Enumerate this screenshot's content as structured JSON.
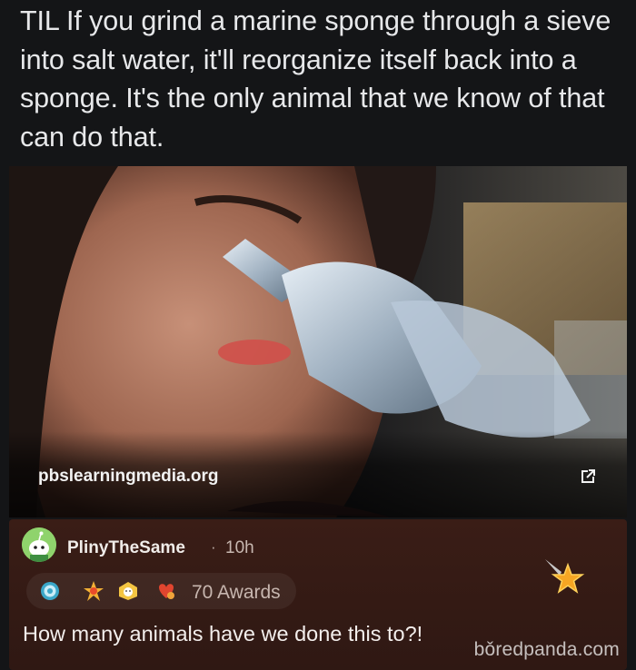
{
  "post": {
    "title": "TIL If you grind a marine sponge through a sieve into salt water, it'll reorganize itself back into a sponge. It's the only animal that we know of that can do that."
  },
  "link_preview": {
    "domain": "pbslearningmedia.org",
    "icon": "external-link-icon"
  },
  "comment": {
    "username": "PlinyTheSame",
    "separator": "·",
    "time": "10h",
    "awards_label": "70 Awards",
    "award_icons": [
      "silver-award-icon",
      "fire-award-icon",
      "helpful-award-icon",
      "wholesome-award-icon"
    ],
    "featured_award_icon": "star-award-icon",
    "body": "How many animals have we done this to?!"
  },
  "watermark": "bǒredpanda.com",
  "colors": {
    "background": "#141517",
    "comment_background": "#3a1d16",
    "title_text": "#e7e8ea"
  }
}
